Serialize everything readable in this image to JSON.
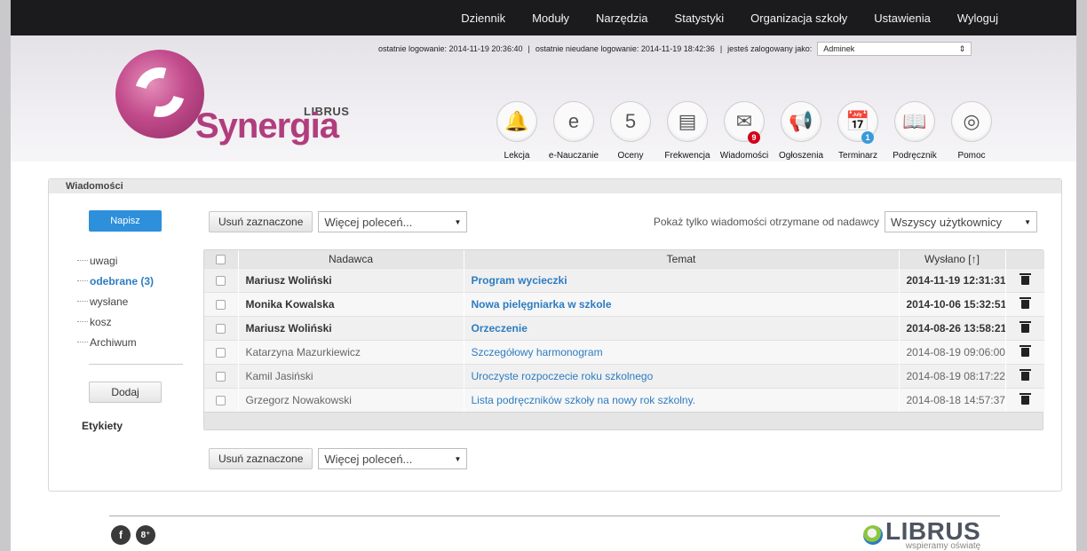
{
  "nav": [
    "Dziennik",
    "Moduły",
    "Narzędzia",
    "Statystyki",
    "Organizacja szkoły",
    "Ustawienia",
    "Wyloguj"
  ],
  "login": {
    "last_login": "ostatnie logowanie: 2014-11-19 20:36:40",
    "last_failed": "ostatnie nieudane logowanie: 2014-11-19 18:42:36",
    "logged_as": "jesteś zalogowany jako:",
    "user": "Adminek",
    "separator": "|"
  },
  "logo": {
    "brand_top": "LIBRUS",
    "brand_main": "Synergia"
  },
  "modules": [
    {
      "label": "Lekcja",
      "icon": "bell-icon",
      "glyph": "🔔"
    },
    {
      "label": "e-Nauczanie",
      "icon": "e-learning-icon",
      "glyph": "e"
    },
    {
      "label": "Oceny",
      "icon": "grades-icon",
      "glyph": "5"
    },
    {
      "label": "Frekwencja",
      "icon": "attendance-icon",
      "glyph": "▤"
    },
    {
      "label": "Wiadomości",
      "icon": "envelope-icon",
      "glyph": "✉",
      "badge": "9",
      "badge_color": "#d0021b"
    },
    {
      "label": "Ogłoszenia",
      "icon": "megaphone-icon",
      "glyph": "📢"
    },
    {
      "label": "Terminarz",
      "icon": "calendar-icon",
      "glyph": "📅",
      "badge": "1",
      "badge_color": "#3a9ad9"
    },
    {
      "label": "Podręcznik",
      "icon": "book-icon",
      "glyph": "📖"
    },
    {
      "label": "Pomoc",
      "icon": "lifebuoy-icon",
      "glyph": "◎"
    }
  ],
  "panel": {
    "title": "Wiadomości"
  },
  "sidebar": {
    "compose": "Napisz",
    "folders": [
      {
        "label": "uwagi",
        "active": false
      },
      {
        "label": "odebrane (3)",
        "active": true
      },
      {
        "label": "wysłane",
        "active": false
      },
      {
        "label": "kosz",
        "active": false
      },
      {
        "label": "Archiwum",
        "active": false
      }
    ],
    "add": "Dodaj",
    "labels_title": "Etykiety"
  },
  "toolbar": {
    "delete_selected": "Usuń zaznaczone",
    "more_commands": "Więcej poleceń...",
    "filter_label": "Pokaż tylko wiadomości otrzymane od nadawcy",
    "filter_value": "Wszyscy użytkownicy"
  },
  "table": {
    "headers": {
      "sender": "Nadawca",
      "subject": "Temat",
      "sent": "Wysłano [↑]"
    },
    "rows": [
      {
        "sender": "Mariusz Woliński",
        "subject": "Program wycieczki",
        "sent": "2014-11-19 12:31:31",
        "unread": true
      },
      {
        "sender": "Monika Kowalska",
        "subject": "Nowa pielęgniarka w szkole",
        "sent": "2014-10-06 15:32:51",
        "unread": true
      },
      {
        "sender": "Mariusz Woliński",
        "subject": "Orzeczenie",
        "sent": "2014-08-26 13:58:21",
        "unread": true
      },
      {
        "sender": "Katarzyna Mazurkiewicz",
        "subject": "Szczegółowy harmonogram",
        "sent": "2014-08-19 09:06:00",
        "unread": false
      },
      {
        "sender": "Kamil Jasiński",
        "subject": "Uroczyste rozpoczecie roku szkolnego",
        "sent": "2014-08-19 08:17:22",
        "unread": false
      },
      {
        "sender": "Grzegorz Nowakowski",
        "subject": "Lista podręczników szkoły na nowy rok szkolny.",
        "sent": "2014-08-18 14:57:37",
        "unread": false
      }
    ]
  },
  "footer": {
    "facebook": "f",
    "gplus": "8⁺",
    "brand": "LIBRUS",
    "slogan": "wspieramy oświatę"
  }
}
